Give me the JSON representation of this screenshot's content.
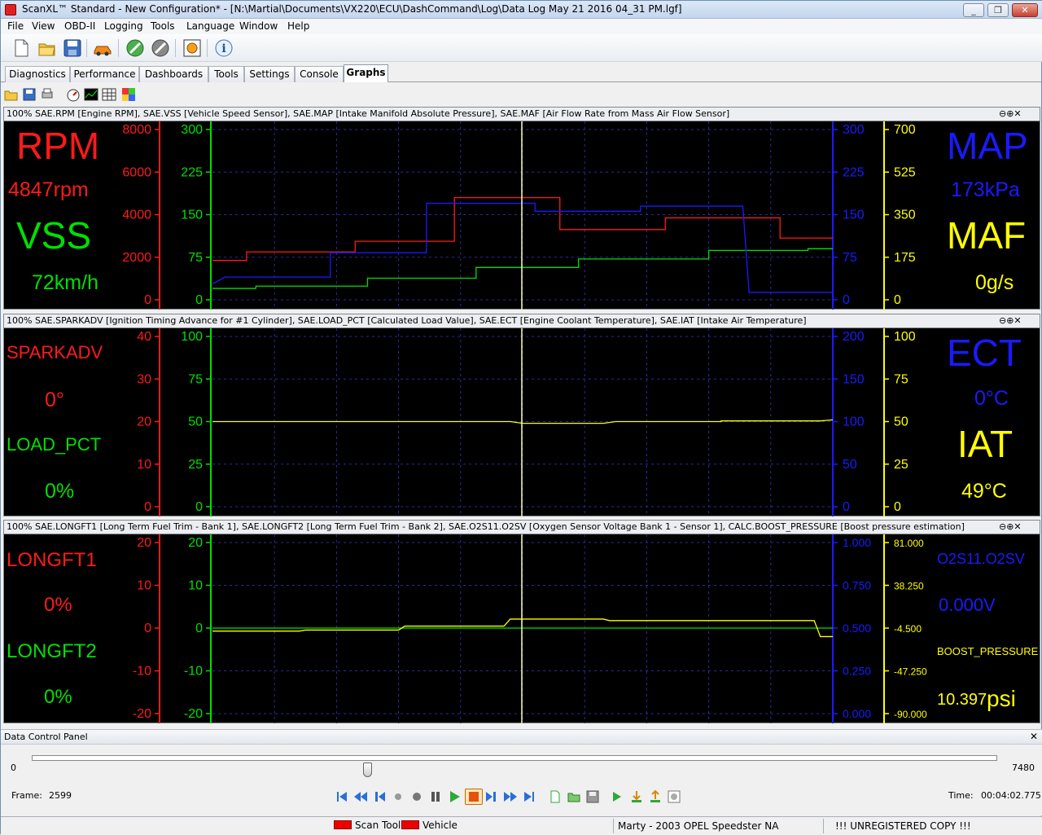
{
  "window": {
    "title": "ScanXL™ Standard - New Configuration* - [N:\\Martial\\Documents\\VX220\\ECU\\DashCommand\\Log\\Data Log May 21 2016 04_31 PM.lgf]",
    "minimize": "_",
    "restore": "❐",
    "close": "✕"
  },
  "menu": [
    "File",
    "View",
    "OBD-II",
    "Logging",
    "Tools",
    "Language",
    "Window",
    "Help"
  ],
  "toolbar": {
    "icons": [
      "new-file-icon",
      "open-folder-icon",
      "save-icon",
      "vehicle-icon",
      "connect-icon",
      "disconnect-icon",
      "settings-icon",
      "info-icon"
    ]
  },
  "tabs": [
    "Diagnostics",
    "Performance",
    "Dashboards",
    "Tools",
    "Settings",
    "Console",
    "Graphs"
  ],
  "active_tab": "Graphs",
  "tab_controls": {
    "menu": "▼",
    "close": "✕"
  },
  "graph_toolbar": {
    "icons": [
      "open-icon",
      "save-icon",
      "print-icon",
      "gauge-icon",
      "chart-icon",
      "table-icon",
      "color-icon"
    ]
  },
  "panel_controls": "⊖⊕✕",
  "colors": {
    "red": "#ff1a1a",
    "green": "#00e000",
    "blue": "#1a1aff",
    "yellow": "#ffff00",
    "grid": "#2a2aa8",
    "cursor": "#ffffa0"
  },
  "cursor_fraction": 0.5,
  "panels": [
    {
      "header": "100% SAE.RPM [Engine RPM], SAE.VSS [Vehicle Speed Sensor], SAE.MAP [Intake Manifold Absolute Pressure], SAE.MAF [Air Flow Rate from Mass Air Flow Sensor]",
      "left": [
        {
          "name": "RPM",
          "value": "4847rpm"
        },
        {
          "name": "VSS",
          "value": "72km/h"
        }
      ],
      "right": [
        {
          "name": "MAP",
          "value": "173kPa"
        },
        {
          "name": "MAF",
          "value": "0g/s"
        }
      ],
      "axes": {
        "red": [
          "8000",
          "6000",
          "4000",
          "2000",
          "0"
        ],
        "green": [
          "300",
          "225",
          "150",
          "75",
          "0"
        ],
        "blue": [
          "300",
          "225",
          "150",
          "75",
          "0"
        ],
        "yellow": [
          "700",
          "525",
          "350",
          "175",
          "0"
        ]
      }
    },
    {
      "header": "100% SAE.SPARKADV [Ignition Timing Advance for #1 Cylinder], SAE.LOAD_PCT [Calculated Load Value], SAE.ECT [Engine Coolant Temperature], SAE.IAT [Intake Air Temperature]",
      "left": [
        {
          "name": "SPARKADV",
          "value": "0°"
        },
        {
          "name": "LOAD_PCT",
          "value": "0%"
        }
      ],
      "right": [
        {
          "name": "ECT",
          "value": "0°C"
        },
        {
          "name": "IAT",
          "value": "49°C"
        }
      ],
      "axes": {
        "red": [
          "40",
          "30",
          "20",
          "10",
          "0"
        ],
        "green": [
          "100",
          "75",
          "50",
          "25",
          "0"
        ],
        "blue": [
          "200",
          "150",
          "100",
          "50",
          "0"
        ],
        "yellow": [
          "100",
          "75",
          "50",
          "25",
          "0"
        ]
      }
    },
    {
      "header": "100% SAE.LONGFT1 [Long Term Fuel Trim - Bank 1], SAE.LONGFT2 [Long Term Fuel Trim - Bank 2], SAE.O2S11.O2SV [Oxygen Sensor Voltage Bank 1 - Sensor 1], CALC.BOOST_PRESSURE [Boost pressure estimation]",
      "left": [
        {
          "name": "LONGFT1",
          "value": "0%"
        },
        {
          "name": "LONGFT2",
          "value": "0%"
        }
      ],
      "right": [
        {
          "name": "O2S11.O2SV",
          "value": "0.000V"
        },
        {
          "name": "BOOST_PRESSURE",
          "value": "10.397",
          "unit": "psi"
        }
      ],
      "axes": {
        "red": [
          "20",
          "10",
          "0",
          "-10",
          "-20"
        ],
        "green": [
          "20",
          "10",
          "0",
          "-10",
          "-20"
        ],
        "blue": [
          "1.000",
          "0.750",
          "0.500",
          "0.250",
          "0.000"
        ],
        "yellow": [
          "81.000",
          "38.250",
          "-4.500",
          "-47.250",
          "-90.000"
        ]
      }
    }
  ],
  "chart_data": [
    {
      "type": "line",
      "series": [
        {
          "name": "RPM",
          "color": "#ff1a1a",
          "ylim": [
            0,
            8000
          ],
          "points": [
            [
              0,
              1850
            ],
            [
              0.055,
              1850
            ],
            [
              0.055,
              2250
            ],
            [
              0.23,
              2250
            ],
            [
              0.23,
              2750
            ],
            [
              0.39,
              2750
            ],
            [
              0.39,
              4800
            ],
            [
              0.56,
              4800
            ],
            [
              0.56,
              3300
            ],
            [
              0.73,
              3300
            ],
            [
              0.73,
              3850
            ],
            [
              0.915,
              3850
            ],
            [
              0.915,
              2900
            ],
            [
              1,
              2900
            ]
          ]
        },
        {
          "name": "VSS",
          "color": "#00e000",
          "ylim": [
            0,
            300
          ],
          "points": [
            [
              0,
              20
            ],
            [
              0.07,
              20
            ],
            [
              0.07,
              24
            ],
            [
              0.25,
              24
            ],
            [
              0.25,
              38
            ],
            [
              0.425,
              38
            ],
            [
              0.425,
              57
            ],
            [
              0.59,
              57
            ],
            [
              0.59,
              72
            ],
            [
              0.8,
              72
            ],
            [
              0.8,
              87
            ],
            [
              0.96,
              87
            ],
            [
              0.96,
              90
            ],
            [
              1,
              90
            ]
          ]
        },
        {
          "name": "MAP",
          "color": "#1a1aff",
          "ylim": [
            0,
            300
          ],
          "points": [
            [
              0,
              28
            ],
            [
              0.02,
              40
            ],
            [
              0.19,
              40
            ],
            [
              0.19,
              83
            ],
            [
              0.345,
              83
            ],
            [
              0.345,
              170
            ],
            [
              0.52,
              170
            ],
            [
              0.52,
              156
            ],
            [
              0.69,
              156
            ],
            [
              0.69,
              165
            ],
            [
              0.855,
              165
            ],
            [
              0.865,
              13
            ],
            [
              1,
              13
            ]
          ]
        },
        {
          "name": "MAF",
          "color": "#ffff00",
          "ylim": [
            0,
            700
          ],
          "points": []
        }
      ]
    },
    {
      "type": "line",
      "series": [
        {
          "name": "SPARKADV",
          "color": "#ff1a1a",
          "ylim": [
            0,
            40
          ],
          "points": []
        },
        {
          "name": "LOAD_PCT",
          "color": "#00e000",
          "ylim": [
            0,
            100
          ],
          "points": []
        },
        {
          "name": "ECT",
          "color": "#1a1aff",
          "ylim": [
            0,
            200
          ],
          "points": []
        },
        {
          "name": "IAT",
          "color": "#ffff00",
          "ylim": [
            0,
            100
          ],
          "points": [
            [
              0,
              50
            ],
            [
              0.48,
              50
            ],
            [
              0.5,
              49
            ],
            [
              0.63,
              49
            ],
            [
              0.65,
              50
            ],
            [
              0.82,
              50
            ],
            [
              0.82,
              50.4
            ],
            [
              0.98,
              50.4
            ],
            [
              1,
              51
            ]
          ]
        }
      ]
    },
    {
      "type": "line",
      "series": [
        {
          "name": "LONGFT1",
          "color": "#ff1a1a",
          "ylim": [
            -20,
            20
          ],
          "points": []
        },
        {
          "name": "LONGFT2",
          "color": "#00e000",
          "ylim": [
            -20,
            20
          ],
          "points": [
            [
              0,
              0
            ],
            [
              1,
              0
            ]
          ]
        },
        {
          "name": "O2S11.O2SV",
          "color": "#1a1aff",
          "ylim": [
            0,
            1
          ],
          "points": []
        },
        {
          "name": "BOOST_PRESSURE",
          "color": "#ffff00",
          "ylim": [
            -90,
            81
          ],
          "points": [
            [
              0,
              -7.5
            ],
            [
              0.14,
              -7.5
            ],
            [
              0.15,
              -6.5
            ],
            [
              0.3,
              -6.5
            ],
            [
              0.31,
              -2.5
            ],
            [
              0.47,
              -2.5
            ],
            [
              0.48,
              4.5
            ],
            [
              0.63,
              4.5
            ],
            [
              0.64,
              3
            ],
            [
              0.97,
              3
            ],
            [
              0.98,
              -13
            ],
            [
              1,
              -13
            ]
          ]
        }
      ]
    }
  ],
  "data_control": {
    "title": "Data Control Panel",
    "min": "0",
    "max": "7480",
    "frame_label": "Frame:",
    "frame": "2599",
    "progress": 0.3475,
    "time_label": "Time:",
    "time": "00:04:02.775",
    "close": "✕"
  },
  "status": {
    "scan_tool": "Scan Tool",
    "vehicle": "Vehicle",
    "profile": "Marty - 2003 OPEL Speedster NA",
    "registration": "!!! UNREGISTERED COPY !!!"
  }
}
